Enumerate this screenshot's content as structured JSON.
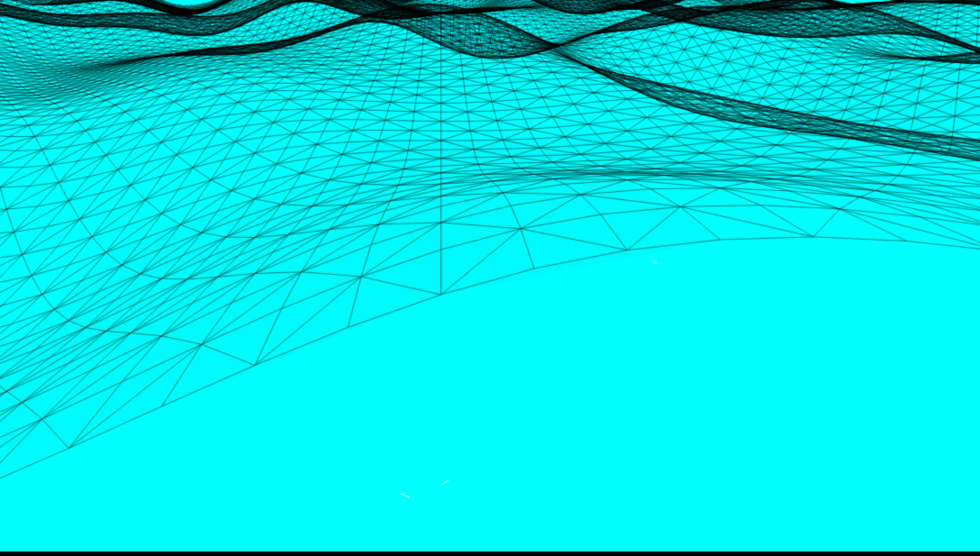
{
  "scene": {
    "render_mode": "wireframe-over-solid",
    "surface": "terrain-heightmap",
    "colors": {
      "fill": "#00ffff",
      "fill_shade": "#00e6ea",
      "wire": "#000000",
      "highlight": "#ffffff",
      "background": "#000000"
    }
  }
}
